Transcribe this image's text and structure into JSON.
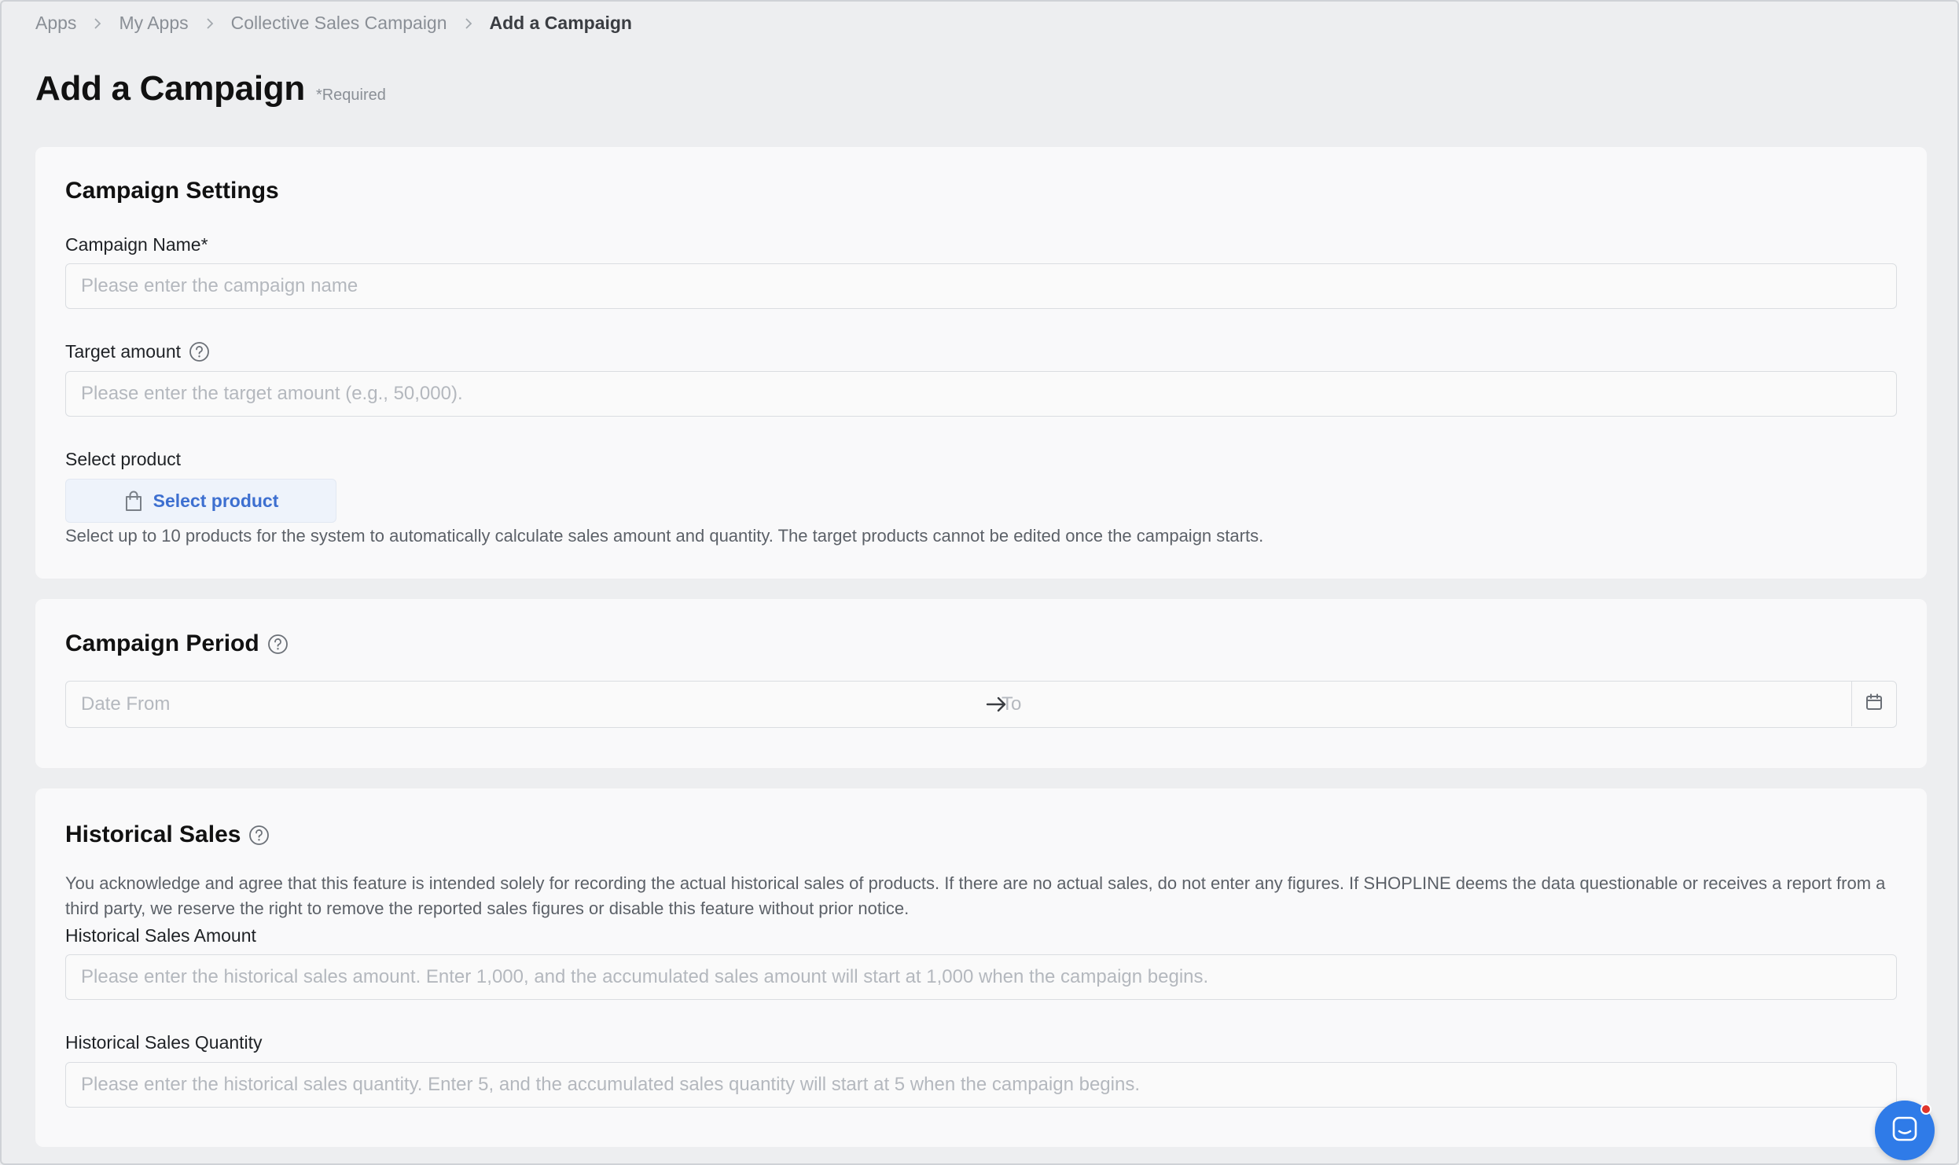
{
  "breadcrumb": {
    "items": [
      "Apps",
      "My Apps",
      "Collective Sales Campaign"
    ],
    "current": "Add a Campaign"
  },
  "page": {
    "title": "Add a Campaign",
    "required_note": "*Required"
  },
  "settings": {
    "title": "Campaign Settings",
    "name_label": "Campaign Name*",
    "name_placeholder": "Please enter the campaign name",
    "target_label": "Target amount",
    "target_placeholder": "Please enter the target amount (e.g., 50,000).",
    "product_label": "Select product",
    "product_button": "Select product",
    "product_helper": "Select up to 10 products for the system to automatically calculate sales amount and quantity. The target products cannot be edited once the campaign starts."
  },
  "period": {
    "title": "Campaign Period",
    "from_placeholder": "Date From",
    "to_placeholder": "To"
  },
  "historical": {
    "title": "Historical Sales",
    "disclaimer": "You acknowledge and agree that this feature is intended solely for recording the actual historical sales of products. If there are no actual sales, do not enter any figures. If SHOPLINE deems the data questionable or receives a report from a third party, we reserve the right to remove the reported sales figures or disable this feature without prior notice.",
    "amount_label": "Historical Sales Amount",
    "amount_placeholder": "Please enter the historical sales amount. Enter 1,000, and the accumulated sales amount will start at 1,000 when the campaign begins.",
    "quantity_label": "Historical Sales Quantity",
    "quantity_placeholder": "Please enter the historical sales quantity. Enter 5, and the accumulated sales quantity will start at 5 when the campaign begins."
  },
  "colors": {
    "accent": "#3d6fd0",
    "background": "#edeef0",
    "card": "#f9f9fa",
    "chat_button": "#2f7be8",
    "notification_dot": "#e0352b"
  },
  "icons": {
    "separator": "chevron-right-icon",
    "help": "question-circle-icon",
    "product_button": "shopping-bag-icon",
    "range_separator": "arrow-right-icon",
    "calendar": "calendar-icon",
    "chat": "chat-icon"
  }
}
